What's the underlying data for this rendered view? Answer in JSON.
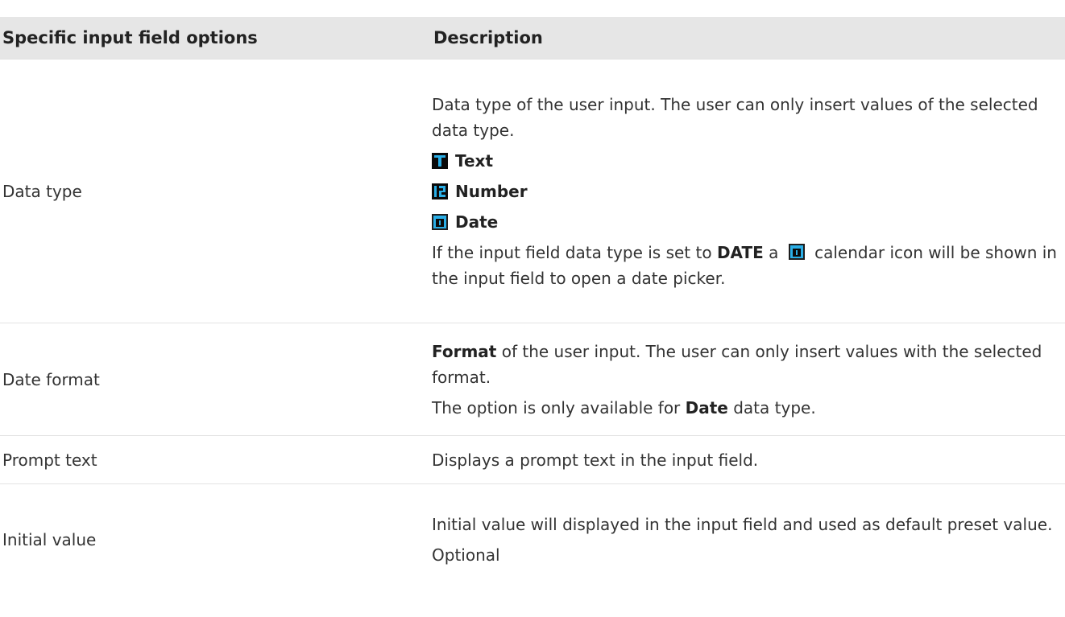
{
  "table": {
    "headers": [
      "Specific input field options",
      "Description"
    ],
    "rows": {
      "data_type": {
        "label": "Data type",
        "desc_p1": "Data type of the user input. The user can only insert values of the selected data type.",
        "options": [
          {
            "icon": "text-type-icon",
            "label": "Text"
          },
          {
            "icon": "number-type-icon",
            "label": "Number"
          },
          {
            "icon": "calendar-icon",
            "label": "Date"
          }
        ],
        "note_prefix": "If the input field data type is set to ",
        "note_bold": "DATE",
        "note_mid": " a ",
        "note_suffix": " calendar icon will be shown in the input field to open a date picker."
      },
      "date_format": {
        "label": "Date format",
        "p1_bold": "Format",
        "p1_rest": " of the user input. The user can only insert values with the selected format.",
        "p2_prefix": "The option is only available for ",
        "p2_bold": "Date",
        "p2_suffix": " data type."
      },
      "prompt_text": {
        "label": "Prompt text",
        "desc": "Displays a prompt text in the input field."
      },
      "initial_value": {
        "label": "Initial value",
        "desc_p1": "Initial value will displayed in the input field and used as default preset value.",
        "desc_p2": "Optional"
      }
    }
  },
  "colors": {
    "header_bg": "#e6e6e6",
    "icon_accent": "#2aaee6",
    "icon_bg": "#0a0a0a",
    "row_border": "#e3e3e3"
  }
}
